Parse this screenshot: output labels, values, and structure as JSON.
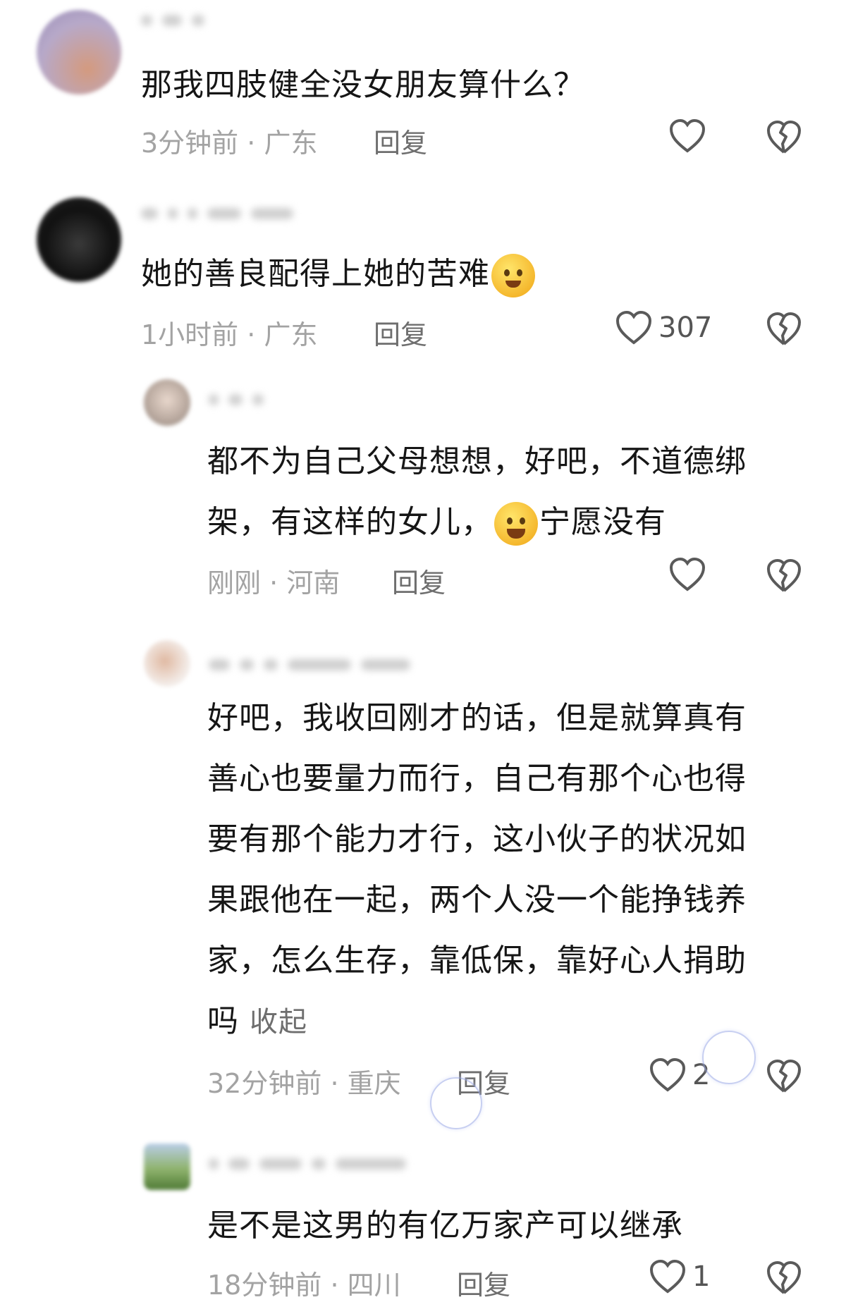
{
  "comments": [
    {
      "text_lines": [
        "那我四肢健全没女朋友算什么？"
      ],
      "time": "3分钟前",
      "location": "广东",
      "reply_label": "回复",
      "like_count": "",
      "icons": {
        "like": "heart-outline-icon",
        "dislike": "broken-heart-icon"
      }
    },
    {
      "text_lines": [
        "她的善良配得上她的苦难"
      ],
      "time": "1小时前",
      "location": "广东",
      "reply_label": "回复",
      "like_count": "307",
      "icons": {
        "like": "heart-outline-icon",
        "dislike": "broken-heart-icon",
        "emoji": "pleading-face-emoji"
      }
    },
    {
      "text_lines": [
        "都不为自己父母想想，好吧，不道德绑",
        "架，有这样的女儿，",
        "宁愿没有"
      ],
      "time": "刚刚",
      "location": "河南",
      "reply_label": "回复",
      "like_count": "",
      "icons": {
        "like": "heart-outline-icon",
        "dislike": "broken-heart-icon",
        "emoji": "laughing-crying-emoji"
      }
    },
    {
      "text_lines": [
        "好吧，我收回刚才的话，但是就算真有",
        "善心也要量力而行，自己有那个心也得",
        "要有那个能力才行，这小伙子的状况如",
        "果跟他在一起，两个人没一个能挣钱养",
        "家，怎么生存，靠低保，靠好心人捐助",
        "吗"
      ],
      "collapse_label": "收起",
      "time": "32分钟前",
      "location": "重庆",
      "reply_label": "回复",
      "like_count": "2",
      "icons": {
        "like": "heart-outline-icon",
        "dislike": "broken-heart-icon"
      }
    },
    {
      "text_lines": [
        "是不是这男的有亿万家产可以继承"
      ],
      "time": "18分钟前",
      "location": "四川",
      "reply_label": "回复",
      "like_count": "1",
      "icons": {
        "like": "heart-outline-icon",
        "dislike": "broken-heart-icon"
      }
    }
  ],
  "meta_separator": " · "
}
